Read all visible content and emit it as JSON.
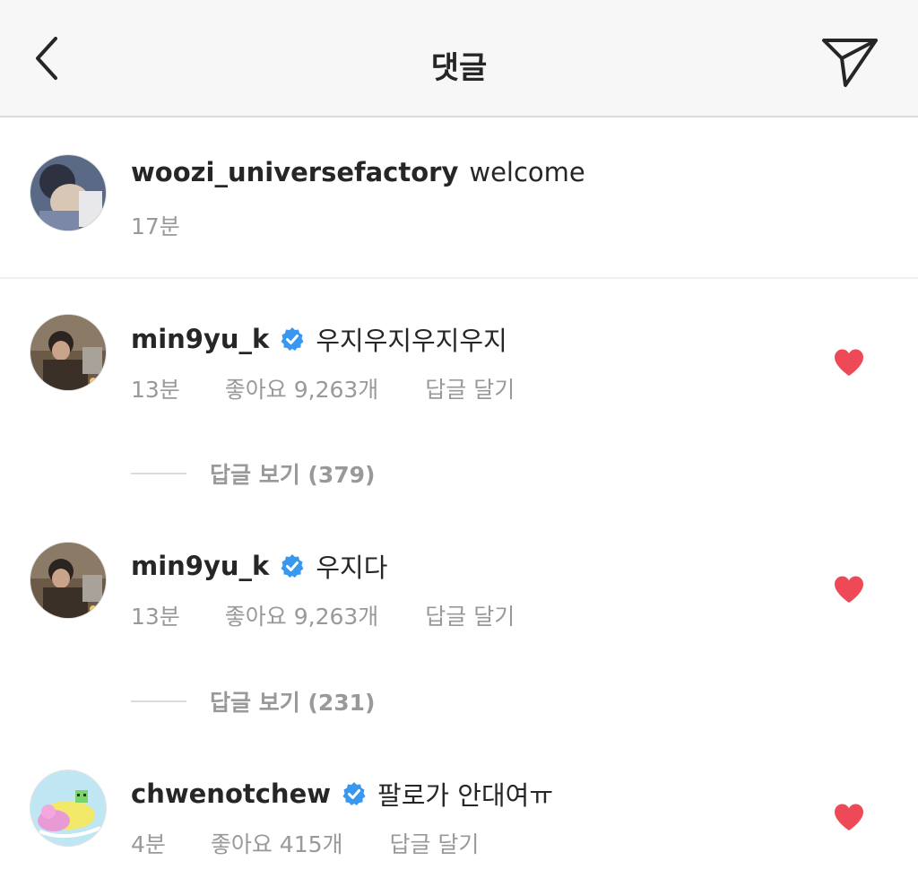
{
  "header": {
    "title": "댓글",
    "back_icon": "chevron-left-icon",
    "share_icon": "paper-plane-icon"
  },
  "caption": {
    "username": "woozi_universefactory",
    "text": "welcome",
    "time": "17분"
  },
  "comments": [
    {
      "username": "min9yu_k",
      "verified": true,
      "text": "우지우지우지우지",
      "time": "13분",
      "likes": "좋아요 9,263개",
      "reply_label": "답글 달기",
      "liked": true,
      "view_replies": "답글 보기 (379)"
    },
    {
      "username": "min9yu_k",
      "verified": true,
      "text": "우지다",
      "time": "13분",
      "likes": "좋아요 9,263개",
      "reply_label": "답글 달기",
      "liked": true,
      "view_replies": "답글 보기 (231)"
    },
    {
      "username": "chwenotchew",
      "verified": true,
      "text": "팔로가 안대여ㅠ",
      "time": "4분",
      "likes": "좋아요 415개",
      "reply_label": "답글 달기",
      "liked": true
    }
  ],
  "colors": {
    "heart": "#ed4956",
    "verified": "#3897f0",
    "meta_text": "#999999"
  }
}
